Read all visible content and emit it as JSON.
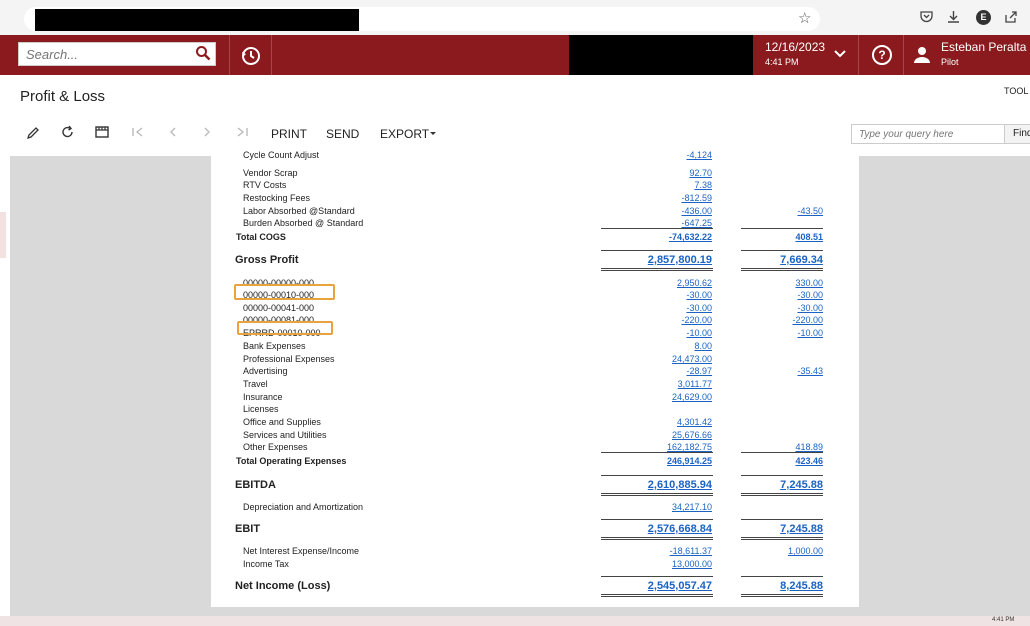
{
  "browser": {
    "icons": [
      "star-icon",
      "pocket-icon",
      "download-icon",
      "extension-e-icon",
      "share-icon"
    ],
    "extension_letter": "E"
  },
  "header": {
    "search_placeholder": "Search...",
    "date": "12/16/2023",
    "time": "4:41 PM",
    "user_name": "Esteban Peralta",
    "user_role": "Pilot",
    "help_label": "?"
  },
  "page": {
    "title": "Profit & Loss",
    "tools_label": "TOOL"
  },
  "toolbar": {
    "print": "PRINT",
    "send": "SEND",
    "export": "EXPORT",
    "query_placeholder": "Type your query here",
    "find": "Find"
  },
  "report": {
    "cut_label": "Cycle Count Adjust",
    "cut_value": "-4,124",
    "rows": [
      {
        "label": "Vendor Scrap",
        "c1": "92.70",
        "c2": ""
      },
      {
        "label": "RTV Costs",
        "c1": "7.38",
        "c2": ""
      },
      {
        "label": "Restocking Fees",
        "c1": "-812.59",
        "c2": ""
      },
      {
        "label": "Labor Absorbed @Standard",
        "c1": "-436.00",
        "c2": "-43.50"
      },
      {
        "label": "Burden Absorbed @ Standard",
        "c1": "-647.25",
        "c2": ""
      },
      {
        "label": "Total COGS",
        "c1": "-74,632.22",
        "c2": "408.51"
      },
      {
        "label": "Gross Profit",
        "c1": "2,857,800.19",
        "c2": "7,669.34"
      },
      {
        "label": "00000-00000-000",
        "c1": "2,950.62",
        "c2": "330.00"
      },
      {
        "label": "00000-00010-000",
        "c1": "-30.00",
        "c2": "-30.00"
      },
      {
        "label": "00000-00041-000",
        "c1": "-30.00",
        "c2": "-30.00"
      },
      {
        "label": "00000-00081-000",
        "c1": "-220.00",
        "c2": "-220.00"
      },
      {
        "label": "EPRRD-00010-000",
        "c1": "-10.00",
        "c2": "-10.00"
      },
      {
        "label": "Bank Expenses",
        "c1": "8.00",
        "c2": ""
      },
      {
        "label": "Professional Expenses",
        "c1": "24,473.00",
        "c2": ""
      },
      {
        "label": "Advertising",
        "c1": "-28.97",
        "c2": "-35.43"
      },
      {
        "label": "Travel",
        "c1": "3,011.77",
        "c2": ""
      },
      {
        "label": "Insurance",
        "c1": "24,629.00",
        "c2": ""
      },
      {
        "label": "Licenses",
        "c1": "",
        "c2": ""
      },
      {
        "label": "Office and Supplies",
        "c1": "4,301.42",
        "c2": ""
      },
      {
        "label": "Services and Utilities",
        "c1": "25,676.66",
        "c2": ""
      },
      {
        "label": "Other Expenses",
        "c1": "162,182.75",
        "c2": "418.89"
      },
      {
        "label": "Total Operating Expenses",
        "c1": "246,914.25",
        "c2": "423.46"
      },
      {
        "label": "EBITDA",
        "c1": "2,610,885.94",
        "c2": "7,245.88"
      },
      {
        "label": "Depreciation and Amortization",
        "c1": "34,217.10",
        "c2": ""
      },
      {
        "label": "EBIT",
        "c1": "2,576,668.84",
        "c2": "7,245.88"
      },
      {
        "label": "Net Interest Expense/Income",
        "c1": "-18,611.37",
        "c2": "1,000.00"
      },
      {
        "label": "Income Tax",
        "c1": "13,000.00",
        "c2": ""
      },
      {
        "label": "Net Income (Loss)",
        "c1": "2,545,057.47",
        "c2": "8,245.88"
      }
    ]
  },
  "footer": {
    "time": "4:41 PM"
  }
}
